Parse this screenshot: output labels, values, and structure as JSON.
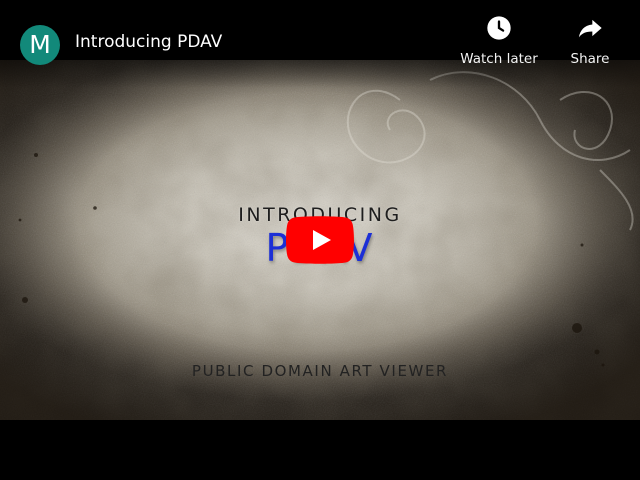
{
  "channel": {
    "avatar_letter": "M",
    "avatar_color": "#12897a"
  },
  "video": {
    "title": "Introducing PDAV",
    "frame_text": {
      "intro": "INTRODUCING",
      "brand": "PDAV",
      "subtitle": "PUBLIC DOMAIN ART VIEWER"
    }
  },
  "actions": {
    "watch_later": {
      "label": "Watch later",
      "icon": "clock-icon"
    },
    "share": {
      "label": "Share",
      "icon": "share-arrow-icon"
    }
  },
  "play_button": {
    "icon": "play-icon",
    "color": "#ff0000"
  },
  "colors": {
    "brand_text": "#1c2fd6",
    "background": "#000000"
  }
}
